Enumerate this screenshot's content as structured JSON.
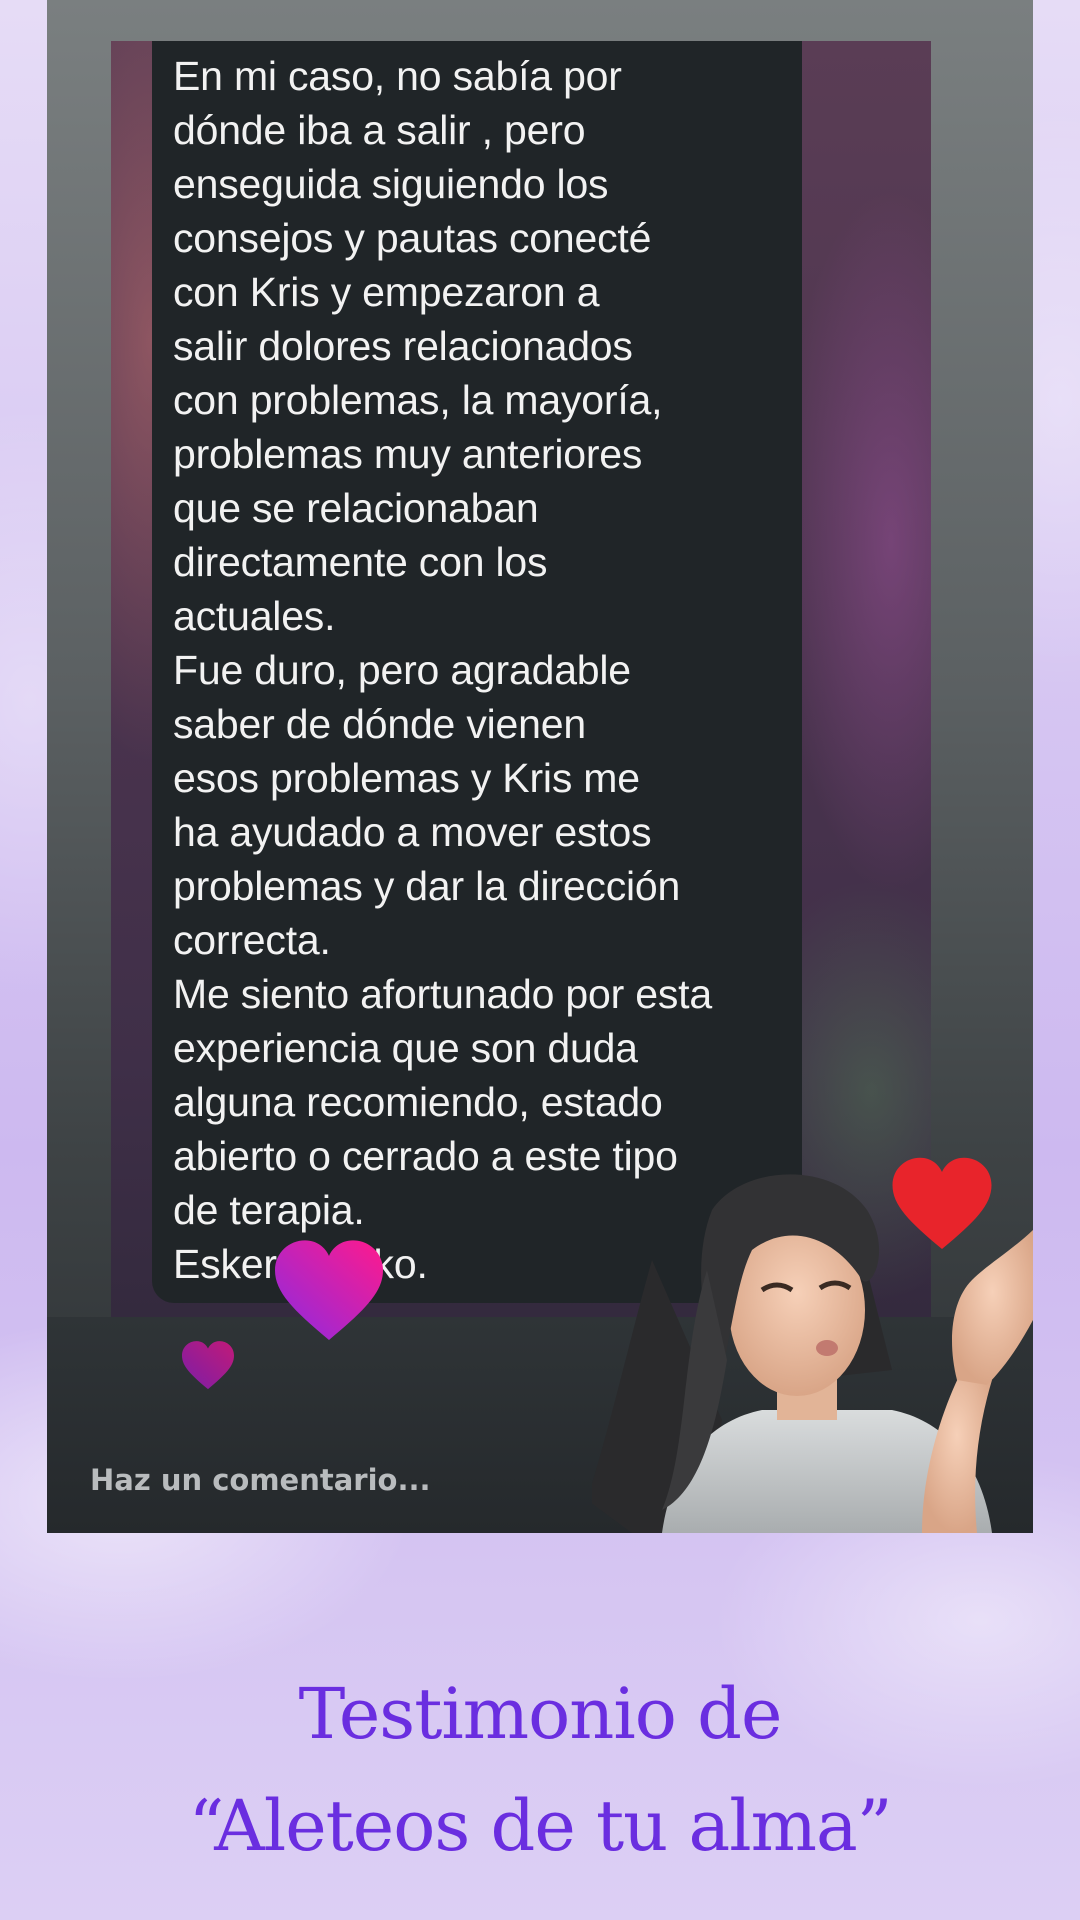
{
  "message": {
    "text": "En mi caso, no sabía por\ndónde iba a salir , pero\nenseguida siguiendo los\nconsejos y pautas conecté\ncon Kris y empezaron a\nsalir dolores relacionados\ncon problemas, la mayoría,\nproblemas muy anteriores\nque se relacionaban\ndirectamente con los\nactuales.\nFue duro, pero agradable\nsaber de dónde vienen\nesos problemas y Kris me\nha ayudado a mover estos\nproblemas y dar la dirección\ncorrecta.\nMe siento afortunado por esta\nexperiencia que son duda\nalguna recomiendo, estado\nabierto o cerrado a este tipo\nde terapia.\nEskerrik asko."
  },
  "comment_bar": {
    "placeholder": "Haz un comentario..."
  },
  "reactions": {
    "icons": [
      "heart-icon",
      "heart-icon",
      "heart-icon"
    ],
    "colors": {
      "pink_heart": "#e0179b",
      "purple_heart": "#8a2be2",
      "red_heart": "#e8242b"
    }
  },
  "caption": {
    "line1": "Testimonio de",
    "line2": "“Aleteos de tu alma”"
  },
  "colors": {
    "caption": "#6a2ee0",
    "bubble": "#202528",
    "background": "#d6c6f2"
  }
}
